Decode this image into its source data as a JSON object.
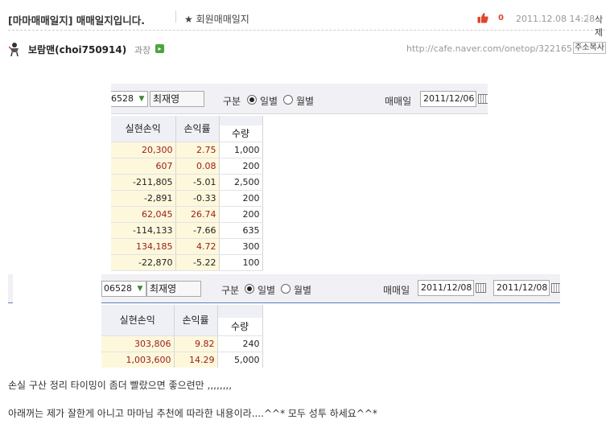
{
  "header": {
    "title": "[마마매매일지] 매매일지입니다.",
    "board": "★ 회원매매일지",
    "like_count": "0",
    "date": "2011.12.08 14:28",
    "delete_label": "삭제"
  },
  "author": {
    "name": "보람맨(choi750914)",
    "rank": "과장",
    "url": "http://cafe.naver.com/onetop/322165",
    "copy_label": "주소복사"
  },
  "panel1": {
    "code": "06528",
    "name": "최재영",
    "gubun_label": "구분",
    "daily_label": "일별",
    "monthly_label": "월별",
    "trade_date_label": "매매일",
    "date": "2011/12/06",
    "columns": [
      "실현손익",
      "손익률",
      "수량"
    ],
    "rows": [
      {
        "pnl": "20,300",
        "pct": "2.75",
        "qty": "1,000",
        "color": "#9b1b1b"
      },
      {
        "pnl": "607",
        "pct": "0.08",
        "qty": "200",
        "color": "#9b1b1b"
      },
      {
        "pnl": "-211,805",
        "pct": "-5.01",
        "qty": "2,500",
        "color": "#222222"
      },
      {
        "pnl": "-2,891",
        "pct": "-0.33",
        "qty": "200",
        "color": "#222222"
      },
      {
        "pnl": "62,045",
        "pct": "26.74",
        "qty": "200",
        "color": "#9b1b1b"
      },
      {
        "pnl": "-114,133",
        "pct": "-7.66",
        "qty": "635",
        "color": "#222222"
      },
      {
        "pnl": "134,185",
        "pct": "4.72",
        "qty": "300",
        "color": "#9b1b1b"
      },
      {
        "pnl": "-22,870",
        "pct": "-5.22",
        "qty": "100",
        "color": "#222222"
      }
    ]
  },
  "panel2": {
    "code": "06528",
    "name": "최재영",
    "gubun_label": "구분",
    "daily_label": "일별",
    "monthly_label": "월별",
    "trade_date_label": "매매일",
    "date_from": "2011/12/08",
    "date_to": "2011/12/08",
    "columns": [
      "실현손익",
      "손익률",
      "수량"
    ],
    "rows": [
      {
        "pnl": "303,806",
        "pct": "9.82",
        "qty": "240",
        "color": "#9b1b1b"
      },
      {
        "pnl": "1,003,600",
        "pct": "14.29",
        "qty": "5,000",
        "color": "#9b1b1b"
      }
    ]
  },
  "body": {
    "line1": "손실 구산 정리 타이밍이 좀더 빨랐으면 좋으련만 ,,,,,,,,",
    "line2": "아래꺼는 제가 잘한게 아니고 마마님 추천에 따라한 내용이라....^^* 모두 성투 하세요^^*"
  },
  "colors": {
    "profit": "#9b1b1b",
    "loss": "#222222",
    "like": "#e2442d"
  }
}
